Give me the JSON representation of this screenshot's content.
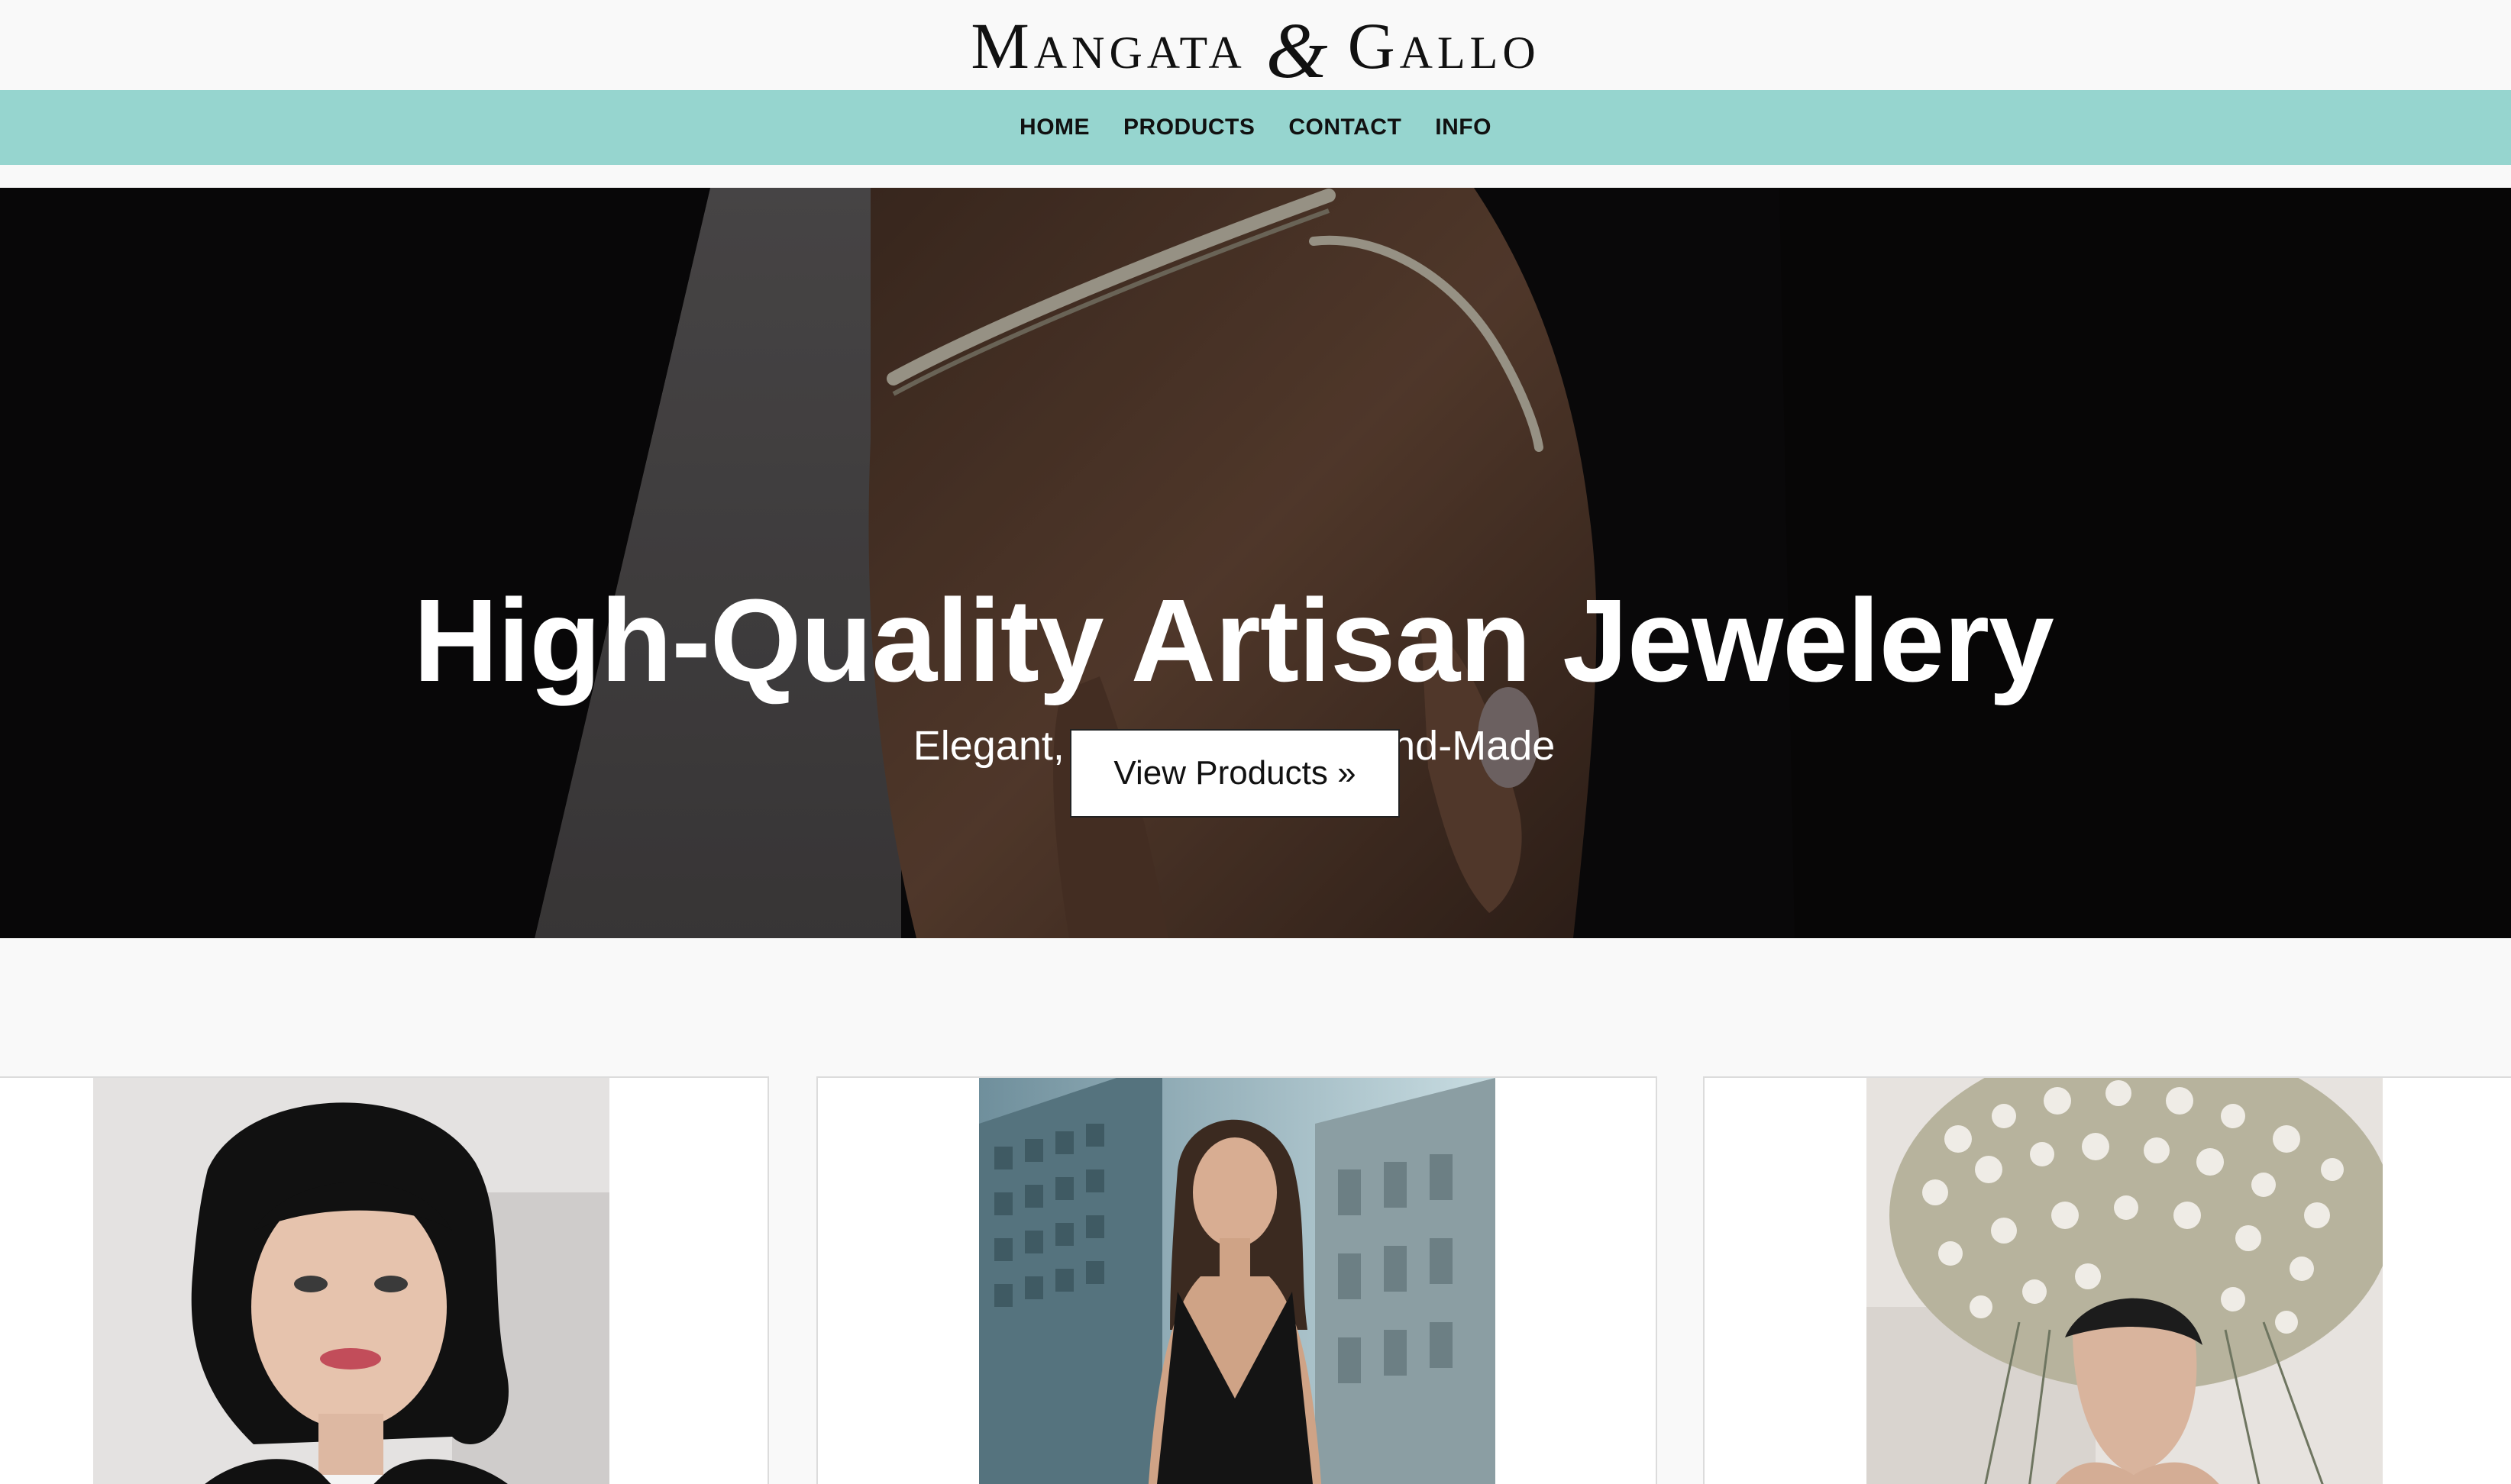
{
  "brand": {
    "logo_word_1": "Mangata",
    "logo_ampersand": "&",
    "logo_word_2": "Gallo"
  },
  "nav": {
    "items": [
      {
        "label": "HOME"
      },
      {
        "label": "PRODUCTS"
      },
      {
        "label": "CONTACT"
      },
      {
        "label": "INFO"
      }
    ],
    "background_color": "#96d5cf"
  },
  "hero": {
    "title": "High-Quality Artisan Jewelery",
    "subtitle": "Elegant, Beautiful, and Hand-Made",
    "button_label": "View Products »",
    "image": "hands-with-diamond-bracelets"
  },
  "products": [
    {
      "image": "portrait-woman-black-bob-earrings"
    },
    {
      "image": "woman-black-dress-city-street"
    },
    {
      "image": "woman-floral-headpiece"
    }
  ]
}
